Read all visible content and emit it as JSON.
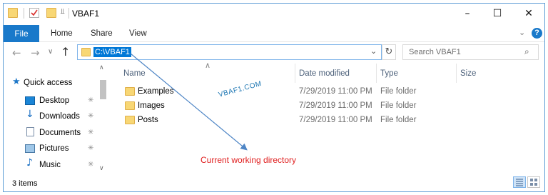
{
  "window": {
    "title": "VBAF1"
  },
  "ribbon": {
    "tabs": [
      "File",
      "Home",
      "Share",
      "View"
    ],
    "help_label": "?"
  },
  "address": {
    "path": "C:\\VBAF1"
  },
  "search": {
    "placeholder": "Search VBAF1"
  },
  "nav_pane": {
    "quick_access": "Quick access",
    "items": [
      "Desktop",
      "Downloads",
      "Documents",
      "Pictures",
      "Music"
    ]
  },
  "columns": {
    "name": "Name",
    "date": "Date modified",
    "type": "Type",
    "size": "Size"
  },
  "files": [
    {
      "name": "Examples",
      "date": "7/29/2019 11:00 PM",
      "type": "File folder"
    },
    {
      "name": "Images",
      "date": "7/29/2019 11:00 PM",
      "type": "File folder"
    },
    {
      "name": "Posts",
      "date": "7/29/2019 11:00 PM",
      "type": "File folder"
    }
  ],
  "watermark": "VBAF1.COM",
  "annotation": "Current working directory",
  "status": {
    "items_count": "3 items"
  },
  "colors": {
    "accent": "#1979ca",
    "annotation": "#e02020",
    "arrow": "#4f86c6",
    "folder": "#f8d775"
  }
}
